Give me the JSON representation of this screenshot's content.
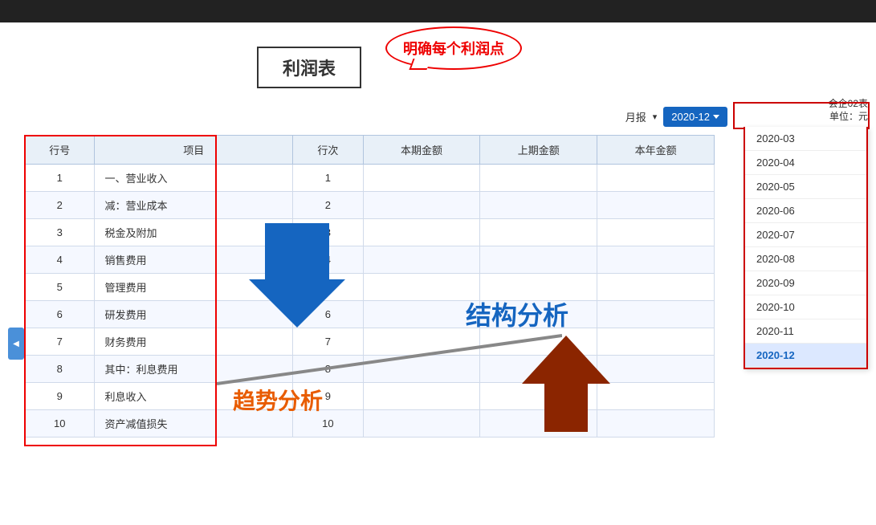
{
  "topbar": {},
  "header": {
    "title": "利润表",
    "bubble_text": "明确每个利润点",
    "company_label": "会企02表",
    "unit_label": "单位：元",
    "report_type_label": "月报",
    "date_selected": "2020-12"
  },
  "toolbar": {
    "report_type": "月报",
    "date_value": "2020-12"
  },
  "dropdown": {
    "items": [
      "2020-03",
      "2020-04",
      "2020-05",
      "2020-06",
      "2020-07",
      "2020-08",
      "2020-09",
      "2020-10",
      "2020-11",
      "2020-12"
    ],
    "active_item": "2020-12"
  },
  "table": {
    "headers": [
      "行号",
      "项目",
      "行次",
      "本期金额",
      "上期金额",
      "本年金"
    ],
    "rows": [
      {
        "row": "1",
        "item": "一、营业收入",
        "seq": "1"
      },
      {
        "row": "2",
        "item": "减：营业成本",
        "seq": "2"
      },
      {
        "row": "3",
        "item": "税金及附加",
        "seq": "3"
      },
      {
        "row": "4",
        "item": "销售费用",
        "seq": "4"
      },
      {
        "row": "5",
        "item": "管理费用",
        "seq": "5"
      },
      {
        "row": "6",
        "item": "研发费用",
        "seq": "6"
      },
      {
        "row": "7",
        "item": "财务费用",
        "seq": "7"
      },
      {
        "row": "8",
        "item": "其中：利息费用",
        "seq": "8"
      },
      {
        "row": "9",
        "item": "利息收入",
        "seq": "9"
      },
      {
        "row": "10",
        "item": "资产减值损失",
        "seq": "10"
      }
    ]
  },
  "overlays": {
    "trend_label": "趋势分析",
    "structure_label": "结构分析"
  }
}
